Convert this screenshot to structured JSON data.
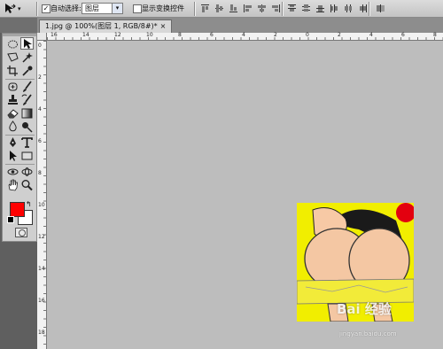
{
  "options_bar": {
    "preset_dropdown": "▾",
    "auto_select_checked": "✓",
    "auto_select_label": "自动选择:",
    "auto_select_value": "图层",
    "show_transform_label": "显示变换控件"
  },
  "document": {
    "tab_title": "1.jpg @ 100%(图层 1, RGB/8#)",
    "modified_marker": "*",
    "close_glyph": "×"
  },
  "ruler": {
    "h_labels": [
      "16",
      "14",
      "12",
      "10",
      "8",
      "6",
      "4",
      "2",
      "0",
      "2",
      "4",
      "6",
      "8"
    ],
    "v_labels": [
      "0",
      "2",
      "4",
      "6",
      "8",
      "10",
      "12",
      "14",
      "16",
      "18"
    ]
  },
  "colors": {
    "foreground": "#ff0000",
    "background": "#ffffff",
    "canvas_bg": "#bdbdbd",
    "image_bg": "#f1ee00"
  },
  "watermark": {
    "logo": "Bai 经验",
    "url": "jingyan.baidu.com"
  }
}
